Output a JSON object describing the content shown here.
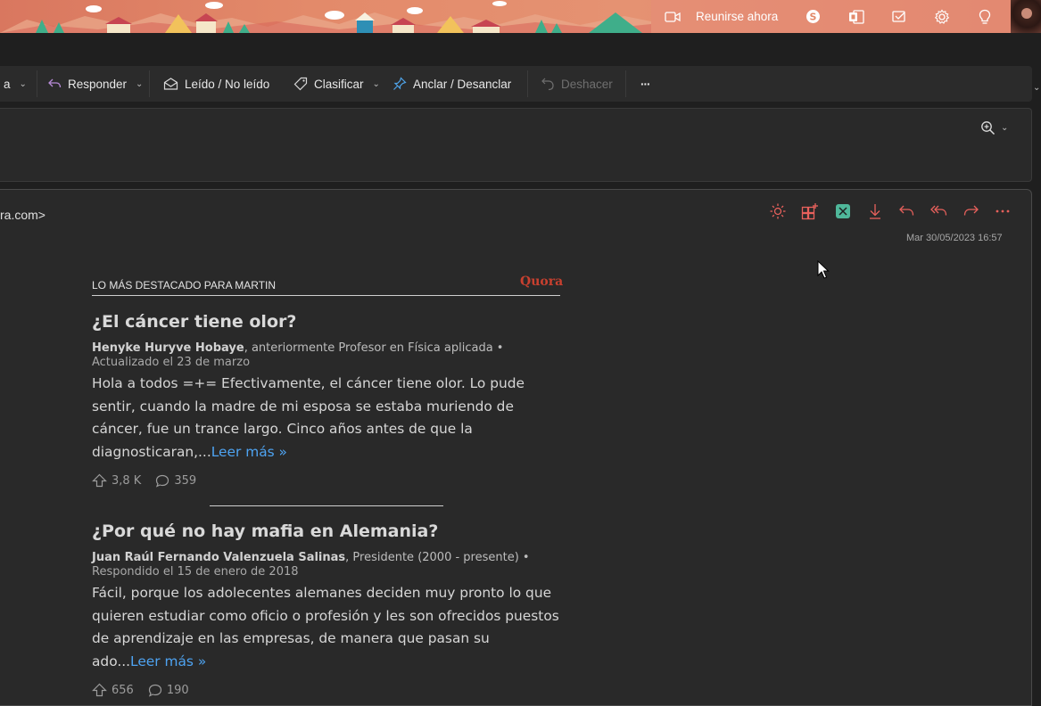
{
  "banner": {
    "meet_now_label": "Reunirse ahora",
    "icons": [
      "video-camera-icon",
      "skype-icon",
      "office-icon",
      "feedback-icon",
      "settings-gear-icon",
      "lightbulb-icon"
    ]
  },
  "toolbar": {
    "move_to_partial": "a",
    "reply_label": "Responder",
    "read_unread_label": "Leído / No leído",
    "categorize_label": "Clasificar",
    "pin_label": "Anclar / Desanclar",
    "undo_label": "Deshacer",
    "more_label": "···"
  },
  "message": {
    "sender_partial": "ra.com>",
    "date": "Mar 30/05/2023 16:57",
    "action_icons": [
      "brightness-icon",
      "add-apps-icon",
      "meeting-icon",
      "download-icon",
      "reply-icon",
      "reply-all-icon",
      "forward-icon",
      "more-icon"
    ],
    "accent_color": "#e8615c"
  },
  "quora": {
    "header_label": "LO MÁS DESTACADO PARA MARTIN",
    "logo": "Quora",
    "stories": [
      {
        "title": "¿El cáncer tiene olor?",
        "author": "Henyke Huryve Hobaye",
        "credential": ", anteriormente Profesor en Física aplicada •",
        "updated": "Actualizado el 23 de marzo",
        "body": "Hola a todos =+= Efectivamente, el cáncer tiene olor. Lo pude sentir, cuando la madre de mi esposa se estaba muriendo de cáncer, fue un trance largo. Cinco años antes de que la diagnosticaran,...",
        "read_more": "Leer más »",
        "upvotes": "3,8 K",
        "comments": "359"
      },
      {
        "title": "¿Por qué no hay mafia en Alemania?",
        "author": "Juan Raúl Fernando Valenzuela Salinas",
        "credential": ", Presidente (2000 - presente) •",
        "updated": "Respondido el 15 de enero de 2018",
        "body": "Fácil, porque los adolecentes alemanes deciden muy pronto lo que quieren estudiar como oficio o profesión y les son ofrecidos puestos de aprendizaje en las empresas, de manera que pasan su ado...",
        "read_more": "Leer más »",
        "upvotes": "656",
        "comments": "190"
      }
    ]
  }
}
